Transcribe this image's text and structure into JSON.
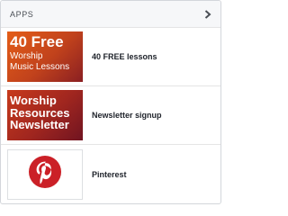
{
  "header": {
    "title": "APPS",
    "more_icon": "chevron-right-icon"
  },
  "apps": [
    {
      "label": "40 FREE lessons",
      "thumb_line1": "40 Free",
      "thumb_line2": "Worship",
      "thumb_line3": "Music Lessons"
    },
    {
      "label": "Newsletter signup",
      "thumb_line1": "Worship",
      "thumb_line2": "Resources",
      "thumb_line3": "Newsletter"
    },
    {
      "label": "Pinterest",
      "icon": "pinterest-logo-icon"
    }
  ],
  "colors": {
    "pinterest_red": "#cb2027",
    "thumb_orange": "#e45d18",
    "thumb_red": "#a0261f"
  }
}
